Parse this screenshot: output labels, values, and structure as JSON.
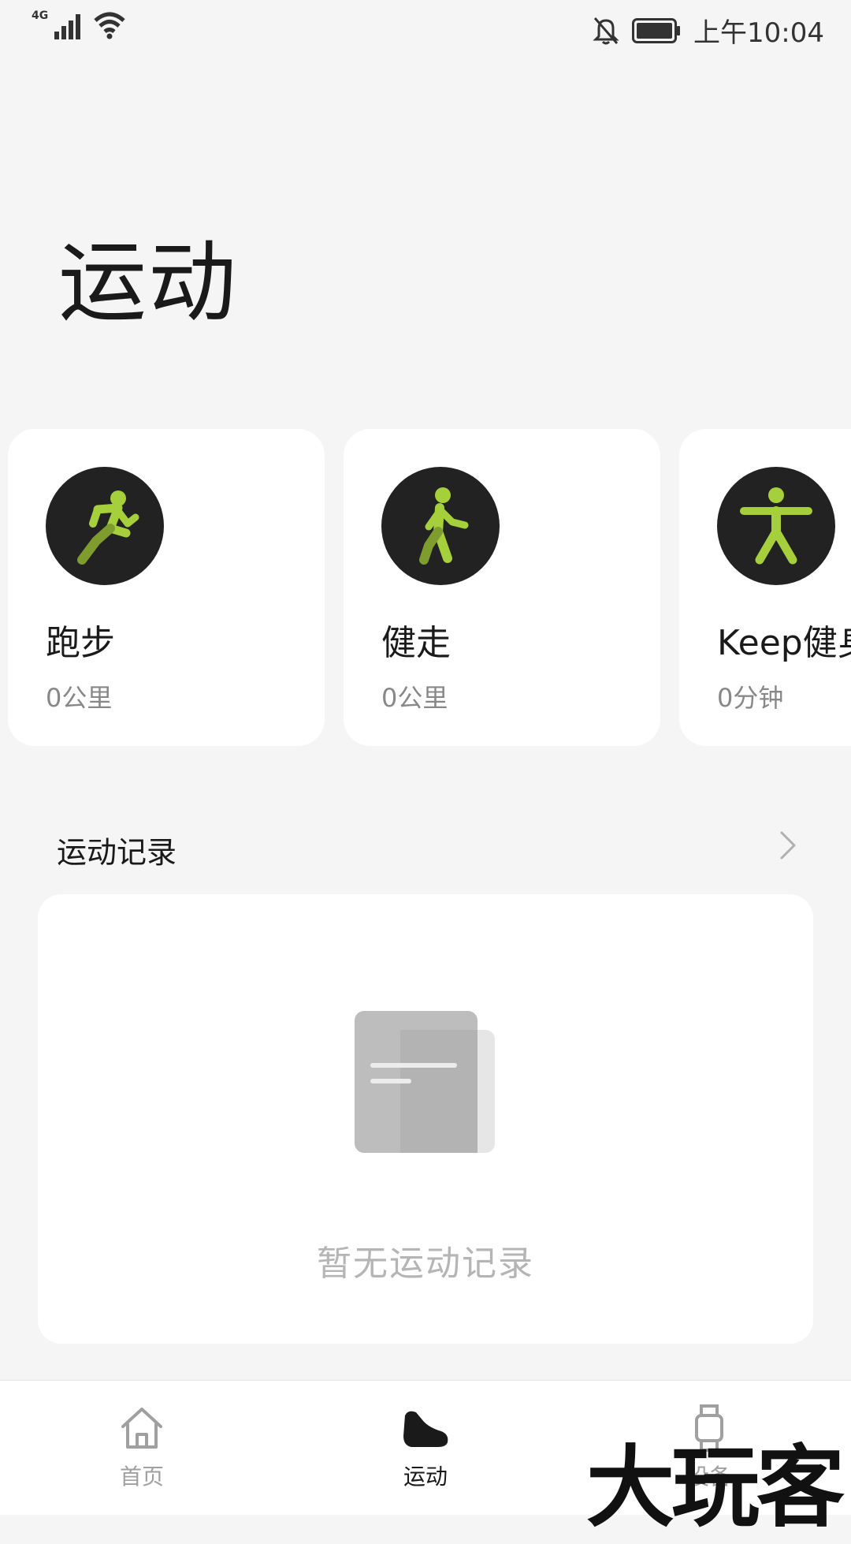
{
  "status_bar": {
    "network_type": "4G",
    "time": "上午10:04"
  },
  "page": {
    "title": "运动"
  },
  "sports": [
    {
      "name": "跑步",
      "stat": "0公里",
      "icon": "running-icon"
    },
    {
      "name": "健走",
      "stat": "0公里",
      "icon": "walking-icon"
    },
    {
      "name": "Keep健身",
      "stat": "0分钟",
      "icon": "fitness-icon"
    }
  ],
  "records": {
    "title": "运动记录",
    "empty_text": "暂无运动记录"
  },
  "nav": {
    "home": "首页",
    "sport": "运动",
    "device": "设备"
  },
  "watermark": "大玩客",
  "colors": {
    "accent": "#a6cf3c",
    "icon_bg": "#222222"
  }
}
